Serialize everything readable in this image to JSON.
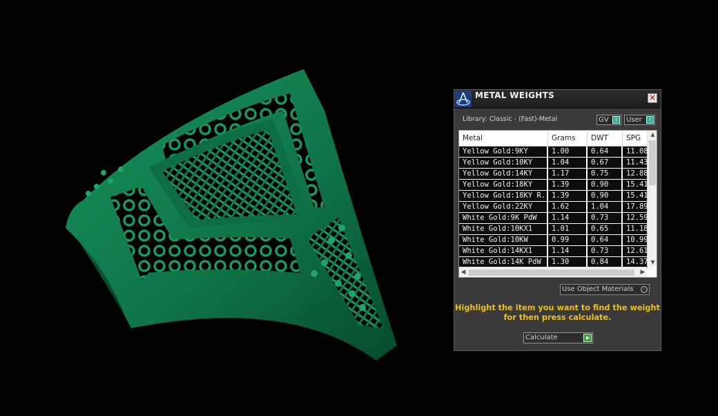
{
  "panel": {
    "title": "METAL WEIGHTS",
    "close_glyph": "×",
    "library_label": "Library: Classic - (Fast)-Metal",
    "toggles": {
      "gv": "GV",
      "user": "User"
    },
    "columns": [
      "Metal",
      "Grams",
      "DWT",
      "SPG"
    ],
    "rows": [
      [
        "Yellow Gold:9KY",
        "1.00",
        "0.64",
        "11.08"
      ],
      [
        "Yellow Gold:10KY",
        "1.04",
        "0.67",
        "11.43"
      ],
      [
        "Yellow Gold:14KY",
        "1.17",
        "0.75",
        "12.88"
      ],
      [
        "Yellow Gold:18KY",
        "1.39",
        "0.90",
        "15.41"
      ],
      [
        "Yellow Gold:18KY R...",
        "1.39",
        "0.90",
        "15.41"
      ],
      [
        "Yellow Gold:22KY",
        "1.62",
        "1.04",
        "17.89"
      ],
      [
        "White Gold:9K PdW",
        "1.14",
        "0.73",
        "12.59"
      ],
      [
        "White Gold:10KX1",
        "1.01",
        "0.65",
        "11.18"
      ],
      [
        "White Gold:10KW",
        "0.99",
        "0.64",
        "10.99"
      ],
      [
        "White Gold:14KX1",
        "1.14",
        "0.73",
        "12.61"
      ],
      [
        "White Gold:14K PdW",
        "1.30",
        "0.84",
        "14.37"
      ]
    ],
    "use_object_materials": "Use Object Materials",
    "hint_line1": "Highlight the item you want to find the weight",
    "hint_line2": "for then press calculate.",
    "calculate_label": "Calculate"
  },
  "colors": {
    "model_green": "#11784c",
    "hint_yellow": "#f0c020",
    "toggle_teal": "#39a6a6",
    "go_green": "#3a9a3a"
  },
  "icons": [
    "app-logo-icon",
    "close-icon",
    "scroll-up-icon",
    "scroll-down-icon",
    "scroll-left-icon",
    "scroll-right-icon",
    "play-icon",
    "radio-icon"
  ]
}
